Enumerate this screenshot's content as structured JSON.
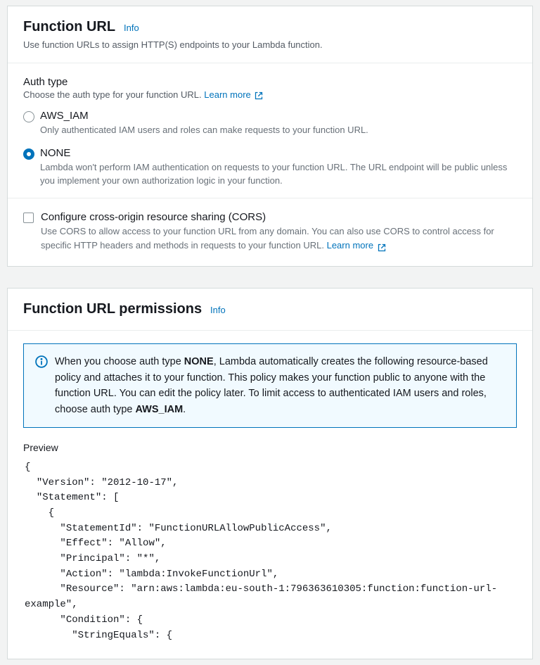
{
  "functionUrl": {
    "title": "Function URL",
    "info": "Info",
    "desc": "Use function URLs to assign HTTP(S) endpoints to your Lambda function."
  },
  "authType": {
    "label": "Auth type",
    "desc": "Choose the auth type for your function URL.",
    "learnMore": "Learn more",
    "options": [
      {
        "value": "AWS_IAM",
        "desc": "Only authenticated IAM users and roles can make requests to your function URL."
      },
      {
        "value": "NONE",
        "desc": "Lambda won't perform IAM authentication on requests to your function URL. The URL endpoint will be public unless you implement your own authorization logic in your function."
      }
    ]
  },
  "cors": {
    "label": "Configure cross-origin resource sharing (CORS)",
    "desc": "Use CORS to allow access to your function URL from any domain. You can also use CORS to control access for specific HTTP headers and methods in requests to your function URL.",
    "learnMore": "Learn more"
  },
  "permissions": {
    "title": "Function URL permissions",
    "info": "Info",
    "alertPrefix": "When you choose auth type ",
    "alertAuth": "NONE",
    "alertMid": ", Lambda automatically creates the following resource-based policy and attaches it to your function. This policy makes your function public to anyone with the function URL. You can edit the policy later. To limit access to authenticated IAM users and roles, choose auth type ",
    "alertAuth2": "AWS_IAM",
    "alertSuffix": ".",
    "previewLabel": "Preview",
    "policy": "{\n  \"Version\": \"2012-10-17\",\n  \"Statement\": [\n    {\n      \"StatementId\": \"FunctionURLAllowPublicAccess\",\n      \"Effect\": \"Allow\",\n      \"Principal\": \"*\",\n      \"Action\": \"lambda:InvokeFunctionUrl\",\n      \"Resource\": \"arn:aws:lambda:eu-south-1:796363610305:function:function-url-example\",\n      \"Condition\": {\n        \"StringEquals\": {"
  }
}
